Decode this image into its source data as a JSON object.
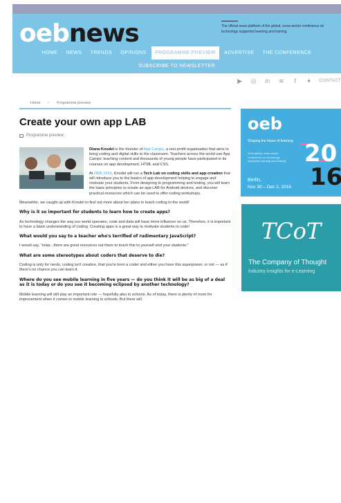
{
  "header": {
    "logo_part1": "oeb",
    "logo_part2": "news",
    "tagline": "The official news platform of the global, cross-sector conference on technology supported learning and training",
    "nav": [
      "HOME",
      "NEWS",
      "TRENDS",
      "OPINIONS",
      "PROGRAMME PREVIEW",
      "ADVERTISE",
      "THE CONFERENCE"
    ],
    "active_nav": "PROGRAMME PREVIEW",
    "subscribe": "SUBSCRIBE TO NEWSLETTER"
  },
  "social": {
    "icons": [
      "youtube-icon",
      "instagram-icon",
      "linkedin-icon",
      "rss-icon",
      "facebook-icon",
      "twitter-icon"
    ],
    "youtube": "▶",
    "instagram": "◎",
    "linkedin": "in",
    "rss": "≋",
    "facebook": "f",
    "twitter": "✦",
    "contact": "CONTACT"
  },
  "breadcrumb": {
    "home": "Home",
    "sep": ">",
    "current": "Programme preview"
  },
  "article": {
    "title": "Create your own app LAB",
    "category": "Programme preview",
    "intro_name": "Diana Knodel",
    "intro_a": " is the founder of ",
    "intro_link": "App Camps",
    "intro_b": ", a non-profit organisation that aims to bring coding and digital skills to the classroom. Teachers across the world use App Camps' teaching content and thousands of young people have participated in its courses on app development, HTML and CSS.",
    "p2_a": "At ",
    "p2_link": "OEB 2016",
    "p2_b": ", Knodel will run a ",
    "p2_strong": "Tech Lab on coding skills and app-creation",
    "p2_c": " that will introduce you to the basics of app development helping to engage and motivate your students. From designing to programming and testing, you will learn the basic principles to create an app LAB for Android devices, and discover practical resources which can be used to offer coding workshops.",
    "p3": "Meanwhile, we caught up with Knodel to find out more about her plans to teach coding to the world!",
    "q1": "Why is it so important for students to learn how to create apps?",
    "a1": "As technology changes the way our world operates, code and data will have more influence on us. Therefore, it is important to have a basic understanding of coding. Creating apps is a great way to motivate students to code!",
    "q2": "What would you say to a teacher who's terrified of rudimentary JavaScript?",
    "a2": "I would say, \"relax...there are great resources out there to teach this to yourself and your students.\"",
    "q3": "What are some stereotypes about coders that deserve to die?",
    "a3": "Coding is only for nerds, coding isn't creative, that you're born a coder and either you have this superpower, or not — as if there's no chance you can learn it.",
    "q4": "Where do you see mobile learning in five years — do you think it will be as big of a deal as it is today or do you see it becoming eclipsed by another technology?",
    "a4": "Mobile learning will still play an important role — hopefully also in schools. As of today, there is plenty of room for improvement when it comes to mobile learning in schools. But there will"
  },
  "sidebar": {
    "ad1": {
      "logo": "oeb",
      "tag": "Shaping the future of learning",
      "small": "22nd global, cross-sector Conference on technology supported learning and training",
      "year_a": "20",
      "year_b": "16",
      "city": "Berlin,",
      "dates": "Nov 30 – Dec 2, 2016"
    },
    "ad2": {
      "script": "TCoT",
      "company": "The Company of Thought",
      "insight": "Industry insights for e-Learning"
    }
  },
  "colors": {
    "accent": "#7ec4e6",
    "link": "#3fa6d8",
    "ad1_bg": "#44aee0",
    "ad2_bg": "#2a9da8"
  }
}
